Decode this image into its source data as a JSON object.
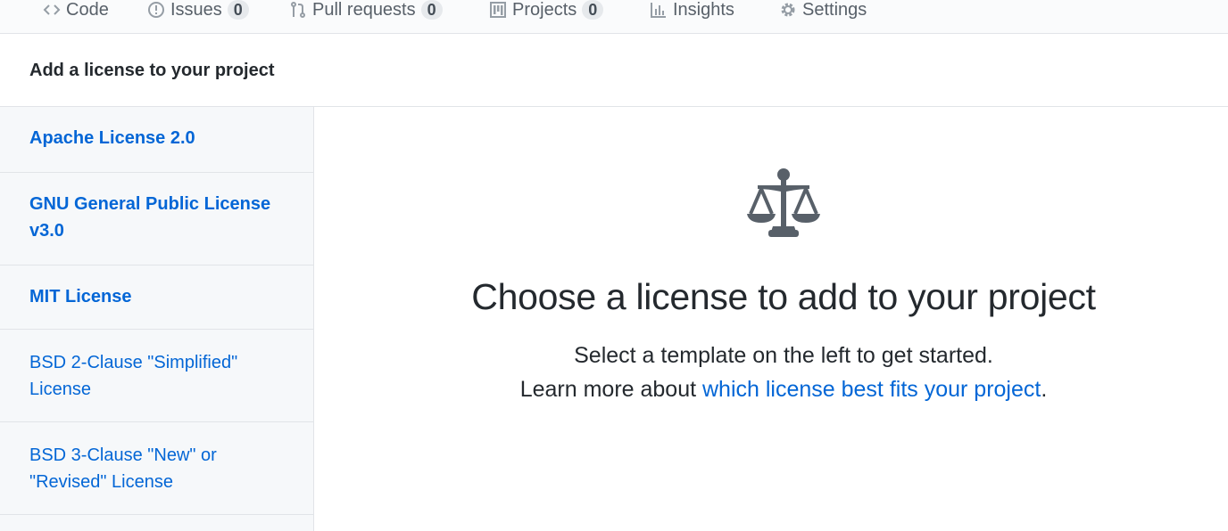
{
  "nav": {
    "tabs": [
      {
        "label": "Code",
        "icon": "code-icon"
      },
      {
        "label": "Issues",
        "icon": "issue-icon",
        "count": "0"
      },
      {
        "label": "Pull requests",
        "icon": "pull-request-icon",
        "count": "0"
      },
      {
        "label": "Projects",
        "icon": "project-icon",
        "count": "0"
      },
      {
        "label": "Insights",
        "icon": "graph-icon"
      },
      {
        "label": "Settings",
        "icon": "gear-icon"
      }
    ]
  },
  "header": {
    "title": "Add a license to your project"
  },
  "sidebar": {
    "items": [
      {
        "label": "Apache License 2.0"
      },
      {
        "label": "GNU General Public License v3.0"
      },
      {
        "label": "MIT License"
      },
      {
        "label": "BSD 2-Clause \"Simplified\" License"
      },
      {
        "label": "BSD 3-Clause \"New\" or \"Revised\" License"
      }
    ]
  },
  "main": {
    "icon": "law-scale-icon",
    "heading": "Choose a license to add to your project",
    "line1": "Select a template on the left to get started.",
    "line2_prefix": "Learn more about ",
    "line2_link": "which license best fits your project",
    "line2_suffix": "."
  },
  "colors": {
    "link": "#0366d6",
    "text": "#24292e",
    "muted": "#586069",
    "sidebar_bg": "#f6f8fa",
    "border": "#e1e4e8",
    "icon": "#586069"
  }
}
